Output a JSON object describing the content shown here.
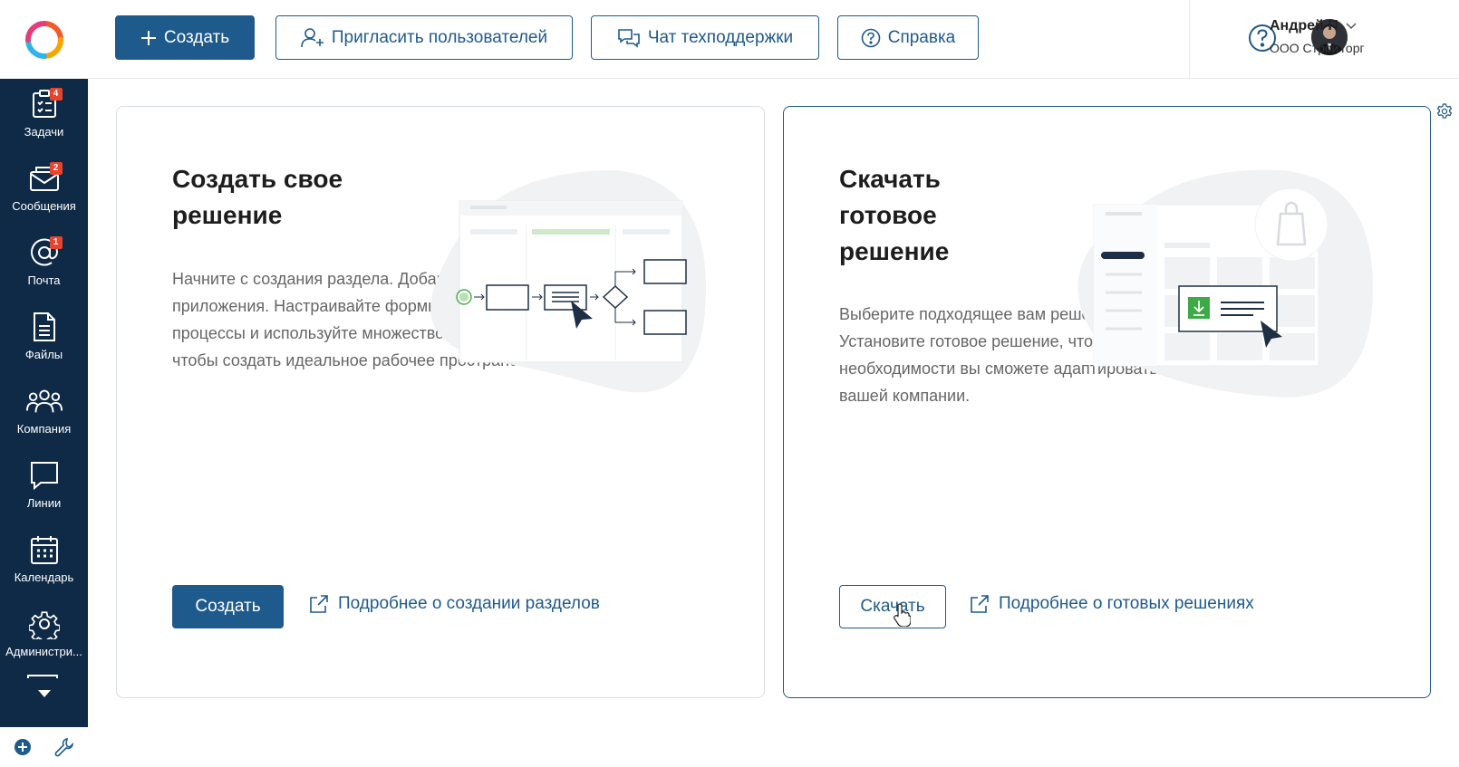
{
  "sidebar": {
    "items": [
      {
        "label": "Задачи",
        "badge": "4",
        "icon": "tasks-icon"
      },
      {
        "label": "Сообщения",
        "badge": "2",
        "icon": "messages-icon"
      },
      {
        "label": "Почта",
        "badge": "1",
        "icon": "mail-icon"
      },
      {
        "label": "Файлы",
        "badge": "",
        "icon": "files-icon"
      },
      {
        "label": "Компания",
        "badge": "",
        "icon": "company-icon"
      },
      {
        "label": "Линии",
        "badge": "",
        "icon": "lines-icon"
      },
      {
        "label": "Календарь",
        "badge": "",
        "icon": "calendar-icon"
      },
      {
        "label": "Администри...",
        "badge": "",
        "icon": "admin-gear-icon"
      }
    ]
  },
  "toolbar": {
    "create_label": "Создать",
    "invite_label": "Пригласить пользователей",
    "support_label": "Чат техподдержки",
    "help_label": "Справка"
  },
  "user": {
    "name": "Андрей П",
    "org": "ООО СтройТорг"
  },
  "cards": {
    "create": {
      "title_line1": "Создать свое",
      "title_line2": "решение",
      "description": "Начните с создания раздела. Добавьте корпоративные приложения. Настраивайте формы, моделируйте бизнес-процессы и используйте множество других возможностей, чтобы создать идеальное рабочее пространство.",
      "button_label": "Создать",
      "link_label": "Подробнее о создании разделов"
    },
    "download": {
      "title_line1": "Скачать",
      "title_line2": "готовое",
      "title_line3": "решение",
      "description": "Выберите подходящее вам решение из каталога ELMA365 Store. Установите готовое решение, чтобы начать работу. При необходимости вы сможете адаптировать его под потребности вашей компании.",
      "button_label": "Скачать",
      "link_label": "Подробнее о готовых решениях"
    }
  },
  "colors": {
    "sidebar_bg": "#0f2a47",
    "primary": "#1f5a8c",
    "badge": "#e8432d"
  }
}
